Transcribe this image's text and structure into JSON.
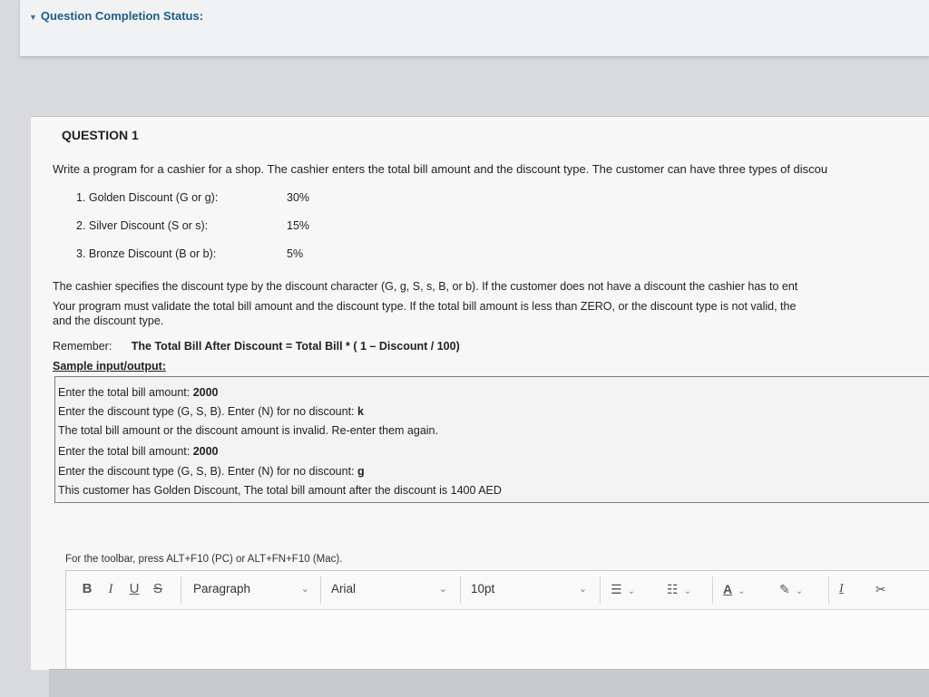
{
  "status": {
    "title": "Question Completion Status:"
  },
  "question": {
    "heading": "QUESTION 1",
    "intro": "Write a program for a cashier for a shop. The cashier enters the total bill amount and the discount type. The customer can have three types of discou",
    "discounts": [
      {
        "label": "1. Golden Discount (G or g):",
        "value": "30%"
      },
      {
        "label": "2. Silver Discount (S or s):",
        "value": "15%"
      },
      {
        "label": "3. Bronze Discount (B or b):",
        "value": "5%"
      }
    ],
    "desc_line1": "The cashier specifies the discount type by the discount character (G, g, S, s, B, or b). If the customer does not have a discount the cashier has to ent",
    "desc_line2": "Your program must validate the total bill amount and the discount type. If the total bill amount is less than ZERO, or the discount type is not valid, the",
    "desc_line3": "and the discount type.",
    "remember_label": "Remember:",
    "formula": "The Total Bill After Discount = Total Bill * ( 1 – Discount / 100)",
    "sample_heading": "Sample input/output:",
    "sample_lines": [
      {
        "text": "Enter the total bill amount: ",
        "input": "2000"
      },
      {
        "text": "Enter the discount type (G, S, B). Enter (N) for no discount: ",
        "input": "k"
      },
      {
        "text": "The total bill amount or the discount amount is invalid. Re-enter them again.",
        "input": ""
      },
      {
        "text": "Enter the total bill amount: ",
        "input": "2000"
      },
      {
        "text": "Enter the discount type (G, S, B). Enter (N) for no discount: ",
        "input": "g"
      },
      {
        "text": "This customer has Golden Discount, The total bill amount after the discount is 1400 AED",
        "input": ""
      }
    ]
  },
  "editor": {
    "toolbar_hint": "For the toolbar, press ALT+F10 (PC) or ALT+FN+F10 (Mac).",
    "bold": "B",
    "italic": "I",
    "underline": "U",
    "strike": "S",
    "paragraph": "Paragraph",
    "font": "Arial",
    "size": "10pt",
    "text_color": "A",
    "clear_format": "I",
    "cut": "✂"
  }
}
